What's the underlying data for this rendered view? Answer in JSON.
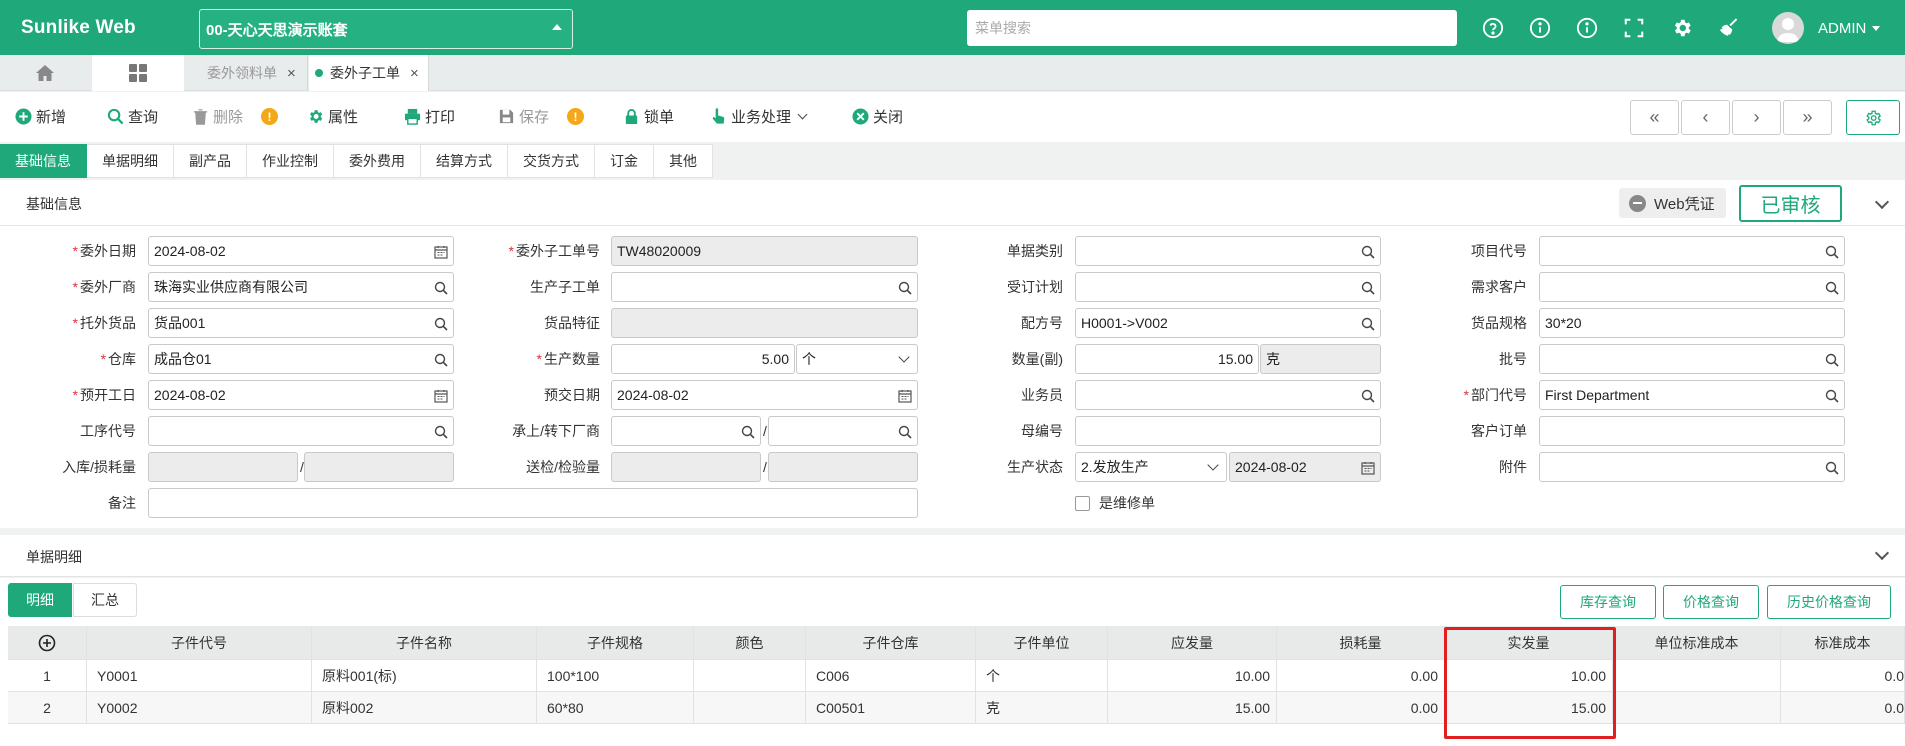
{
  "app": {
    "logo": "Sunlike Web",
    "account": "00-天心天思演示账套",
    "search_placeholder": "菜单搜索",
    "username": "ADMIN"
  },
  "tabs": [
    {
      "label": "委外领料单",
      "close": "×",
      "active": false
    },
    {
      "label": "委外子工单",
      "close": "×",
      "active": true
    }
  ],
  "toolbar": {
    "add": "新增",
    "query": "查询",
    "delete": "删除",
    "props": "属性",
    "print": "打印",
    "save": "保存",
    "lock": "锁单",
    "business": "业务处理",
    "close": "关闭",
    "warn_mark": "!",
    "nav": {
      "first": "«",
      "prev": "‹",
      "next": "›",
      "last": "»"
    }
  },
  "section_tabs": [
    "基础信息",
    "单据明细",
    "副产品",
    "作业控制",
    "委外费用",
    "结算方式",
    "交货方式",
    "订金",
    "其他"
  ],
  "basic": {
    "title": "基础信息",
    "web_voucher": "Web凭证",
    "status": "已审核",
    "req_mark": "*",
    "slash": "/",
    "labels": {
      "wwrq": "委外日期",
      "wwcs": "委外厂商",
      "twhp": "托外货品",
      "ck": "仓库",
      "ykgr": "预开工日",
      "gxdh": "工序代号",
      "rkshl": "入库/损耗量",
      "bz": "备注",
      "wwzgdh": "委外子工单号",
      "sczgd": "生产子工单",
      "hptz": "货品特征",
      "scsl": "生产数量",
      "yjrq": "预交日期",
      "czcs": "承上/转下厂商",
      "sjjyl": "送检/检验量",
      "djlb": "单据类别",
      "ddjh": "受订计划",
      "pfh": "配方号",
      "slf": "数量(副)",
      "ywy": "业务员",
      "mbh": "母编号",
      "sczt": "生产状态",
      "sfwxd": "是维修单",
      "xmdh": "项目代号",
      "xqkh": "需求客户",
      "hpgg": "货品规格",
      "ph": "批号",
      "bmdh": "部门代号",
      "khdd": "客户订单",
      "fj": "附件"
    },
    "values": {
      "wwrq": "2024-08-02",
      "wwcs": "珠海实业供应商有限公司",
      "twhp": "货品001",
      "ck": "成品仓01",
      "ykgr": "2024-08-02",
      "wwzgdh": "TW48020009",
      "scsl": "5.00",
      "scsl_unit": "个",
      "yjrq": "2024-08-02",
      "pfh": "H0001->V002",
      "slf": "15.00",
      "slf_unit": "克",
      "sczt": "2.发放生产",
      "sczt_date": "2024-08-02",
      "hpgg": "30*20",
      "bmdh": "First Department"
    }
  },
  "detail": {
    "title": "单据明细",
    "subtabs": [
      "明细",
      "汇总"
    ],
    "buttons": [
      "库存查询",
      "价格查询",
      "历史价格查询"
    ],
    "columns": [
      "子件代号",
      "子件名称",
      "子件规格",
      "颜色",
      "子件仓库",
      "子件单位",
      "应发量",
      "损耗量",
      "实发量",
      "单位标准成本",
      "标准成本"
    ],
    "rows": [
      {
        "no": "1",
        "code": "Y0001",
        "name": "原料001(标)",
        "spec": "100*100",
        "color": "",
        "wh": "C006",
        "unit": "个",
        "yfl": "10.00",
        "shl": "0.00",
        "sfl": "10.00",
        "unit_cost": "",
        "std_cost": "0.0"
      },
      {
        "no": "2",
        "code": "Y0002",
        "name": "原料002",
        "spec": "60*80",
        "color": "",
        "wh": "C00501",
        "unit": "克",
        "yfl": "15.00",
        "shl": "0.00",
        "sfl": "15.00",
        "unit_cost": "",
        "std_cost": "0.0"
      }
    ]
  },
  "colors": {
    "brand": "#1fa97a",
    "highlight": "#e02020",
    "warning": "#f2a818"
  }
}
